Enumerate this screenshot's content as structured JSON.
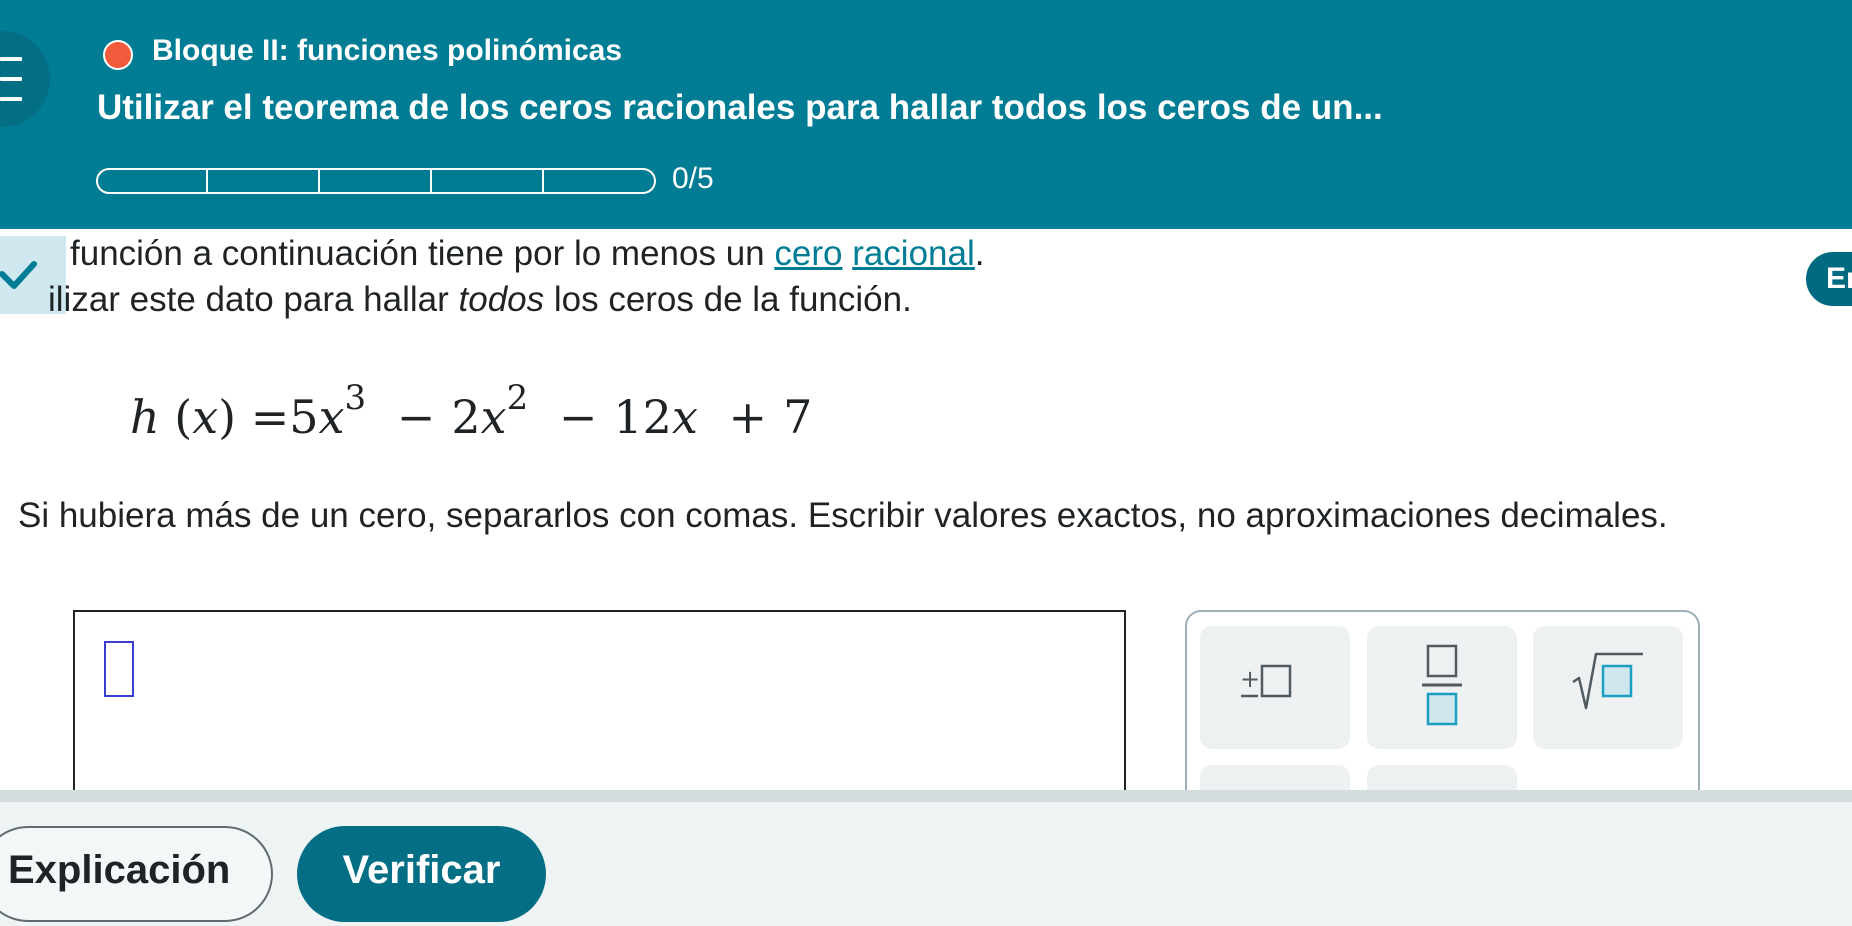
{
  "header": {
    "block_title": "Bloque II: funciones polinómicas",
    "topic_title": "Utilizar el teorema de los ceros racionales para hallar todos los ceros de un...",
    "progress": {
      "label": "0/5",
      "completed": 0,
      "total": 5
    }
  },
  "problem": {
    "line1_prefix": "función a continuación tiene por lo menos un ",
    "link_cero": "cero",
    "link_space": " ",
    "link_racional": "racional",
    "line1_suffix": ".",
    "line2_prefix": "ilizar este dato para hallar ",
    "line2_emphasis": "todos",
    "line2_suffix": " los ceros de la función.",
    "right_pill_label": "Er",
    "equation": {
      "fname": "h",
      "lparen": "(",
      "var": "x",
      "rparen": ")",
      "equals": "=",
      "t1_coef": "5",
      "t1_var": "x",
      "t1_exp": "3",
      "op1": "−",
      "t2_coef": "2",
      "t2_var": "x",
      "t2_exp": "2",
      "op2": "−",
      "t3_coef": "12",
      "t3_var": "x",
      "op3": "+",
      "t4": "7"
    },
    "instructions": "Si hubiera más de un cero, separarlos con comas. Escribir valores exactos, no aproximaciones decimales."
  },
  "palette": {
    "buttons": [
      {
        "icon": "plus-minus-box-icon"
      },
      {
        "icon": "fraction-icon"
      },
      {
        "icon": "square-root-icon"
      }
    ]
  },
  "footer": {
    "explain_label": "Explicación",
    "verify_label": "Verificar"
  },
  "colors": {
    "header_bg": "#007c95",
    "accent": "#046e84",
    "status_dot": "#f25a3c",
    "link": "#007c95",
    "caret": "#3b3fd0"
  }
}
